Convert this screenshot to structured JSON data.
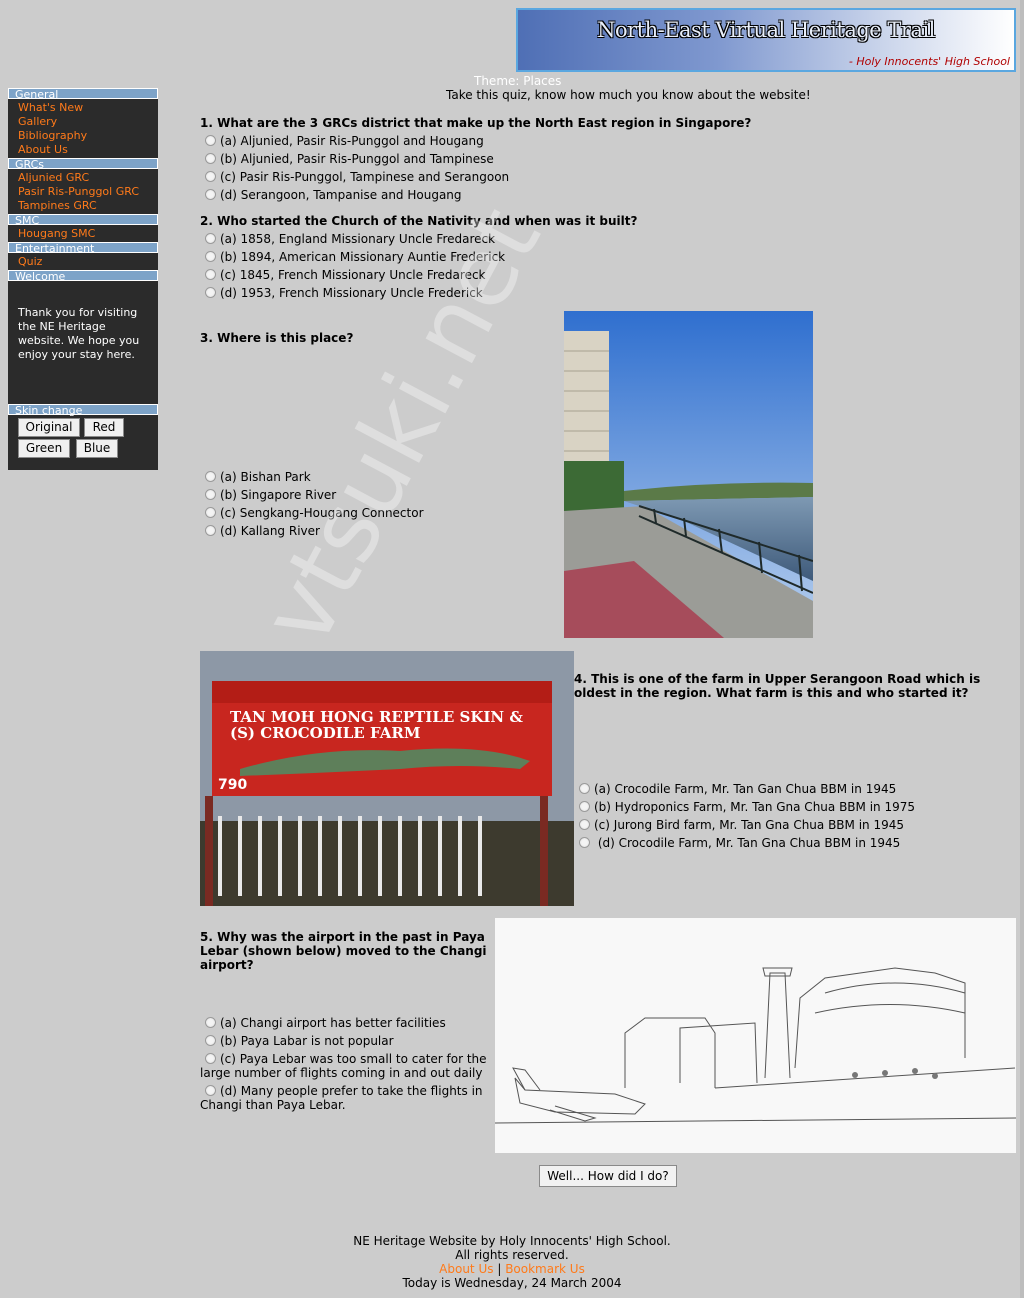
{
  "banner": {
    "title": "North-East Virtual Heritage Trail",
    "subtitle": "- Holy Innocents' High School"
  },
  "sidebar": {
    "sections": [
      {
        "header": "General",
        "items": [
          "What's New",
          "Gallery",
          "Bibliography",
          "About Us"
        ]
      },
      {
        "header": "GRCs",
        "items": [
          "Aljunied GRC",
          "Pasir Ris-Punggol GRC",
          "Tampines GRC"
        ]
      },
      {
        "header": "SMC",
        "items": [
          "Hougang SMC"
        ]
      },
      {
        "header": "Entertainment",
        "items": []
      },
      {
        "header": "Welcome",
        "items": [
          "Quiz"
        ]
      }
    ],
    "welcome_text": "Thank you for visiting the NE Heritage website. We hope you enjoy your stay here.",
    "skin_header": "Skin change",
    "skins": [
      "Original",
      "Red",
      "Green",
      "Blue"
    ]
  },
  "main": {
    "theme": "Theme: Places",
    "intro": "Take this quiz, know how much you know about the website!",
    "questions": [
      {
        "text": "1. What are the 3 GRCs district that make up the North East region in Singapore?",
        "options": [
          "(a) Aljunied, Pasir Ris-Punggol and Hougang",
          "(b) Aljunied, Pasir Ris-Punggol and Tampinese",
          "(c) Pasir Ris-Punggol, Tampinese and Serangoon",
          "(d) Serangoon, Tampanise and Hougang"
        ]
      },
      {
        "text": "2. Who started the Church of the Nativity and when was it built?",
        "options": [
          "(a) 1858, England Missionary Uncle Fredareck",
          "(b) 1894, American Missionary Auntie Frederick",
          "(c) 1845, French Missionary Uncle Fredareck",
          "(d) 1953, French Missionary Uncle Frederick"
        ]
      },
      {
        "text": "3. Where is this place?",
        "options": [
          "(a) Bishan Park",
          "(b) Singapore River",
          "(c) Sengkang-Hougang Connector",
          "(d) Kallang River"
        ]
      },
      {
        "text": "4. This is one of the farm in Upper Serangoon Road which is oldest in the region. What farm is this and who started it?",
        "options": [
          "(a) Crocodile Farm, Mr. Tan Gan Chua BBM in 1945",
          "(b) Hydroponics Farm, Mr. Tan Gna Chua BBM in 1975",
          "(c) Jurong Bird farm, Mr. Tan Gna Chua BBM in 1945",
          " (d) Crocodile Farm, Mr. Tan Gna Chua BBM in 1945"
        ]
      },
      {
        "text": "5. Why was the airport in the past in Paya Lebar (shown below) moved to the Changi airport?",
        "options": [
          "(a) Changi airport has better facilities",
          "(b) Paya Labar is not popular",
          "(c) Paya Lebar was too small to cater for the large number of flights coming in and out daily",
          "(d) Many people prefer to take the flights in Changi than Paya Lebar."
        ]
      }
    ],
    "sign_text": "TAN MOH HONG REPTILE SKIN & (S) CROCODILE FARM",
    "sign_number": "790",
    "submit_label": "Well... How did I do?"
  },
  "footer": {
    "line1": "NE Heritage Website by Holy Innocents' High School.",
    "line2": "All rights reserved.",
    "link_about": "About Us",
    "separator": "|",
    "link_bookmark": "Bookmark Us",
    "date": "Today is Wednesday, 24 March 2004"
  },
  "watermark": "vtsuki.net",
  "colors": {
    "link": "#ff7a1a",
    "sidebar_bg": "#2b2b2b",
    "section_header": "#7da3c8",
    "page_bg": "#cccccc"
  }
}
